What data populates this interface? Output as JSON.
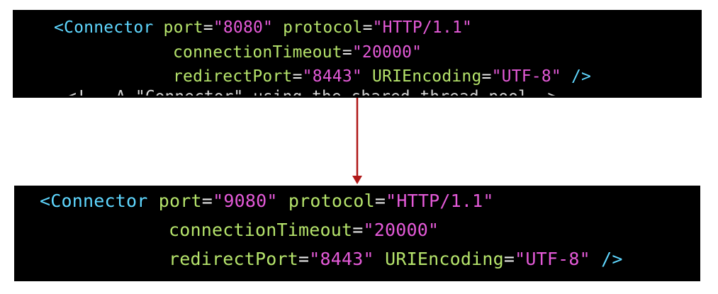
{
  "top_snippet": {
    "line1": {
      "tag": "<Connector",
      "port_attr": "port",
      "eq1": "=",
      "port_val": "\"8080\"",
      "protocol_attr": "protocol",
      "eq2": "=",
      "protocol_val": "\"HTTP/1.1\""
    },
    "line2": {
      "timeout_attr": "connectionTimeout",
      "eq": "=",
      "timeout_val": "\"20000\""
    },
    "line3": {
      "redirect_attr": "redirectPort",
      "eq1": "=",
      "redirect_val": "\"8443\"",
      "uri_attr": "URIEncoding",
      "eq2": "=",
      "uri_val": "\"UTF-8\"",
      "close": "/>"
    },
    "cut_comment": "<!-- A \"Connector\" using the shared thread pool-->"
  },
  "bottom_snippet": {
    "line1": {
      "tag": "<Connector",
      "port_attr": "port",
      "eq1": "=",
      "port_val": "\"9080\"",
      "protocol_attr": "protocol",
      "eq2": "=",
      "protocol_val": "\"HTTP/1.1\""
    },
    "line2": {
      "timeout_attr": "connectionTimeout",
      "eq": "=",
      "timeout_val": "\"20000\""
    },
    "line3": {
      "redirect_attr": "redirectPort",
      "eq1": "=",
      "redirect_val": "\"8443\"",
      "uri_attr": "URIEncoding",
      "eq2": "=",
      "uri_val": "\"UTF-8\"",
      "close": "/>"
    }
  },
  "colors": {
    "background": "#ffffff",
    "code_bg": "#000000",
    "tag": "#5fd7ff",
    "attribute": "#b5e36b",
    "value": "#e45ad8",
    "arrow": "#b01818"
  }
}
